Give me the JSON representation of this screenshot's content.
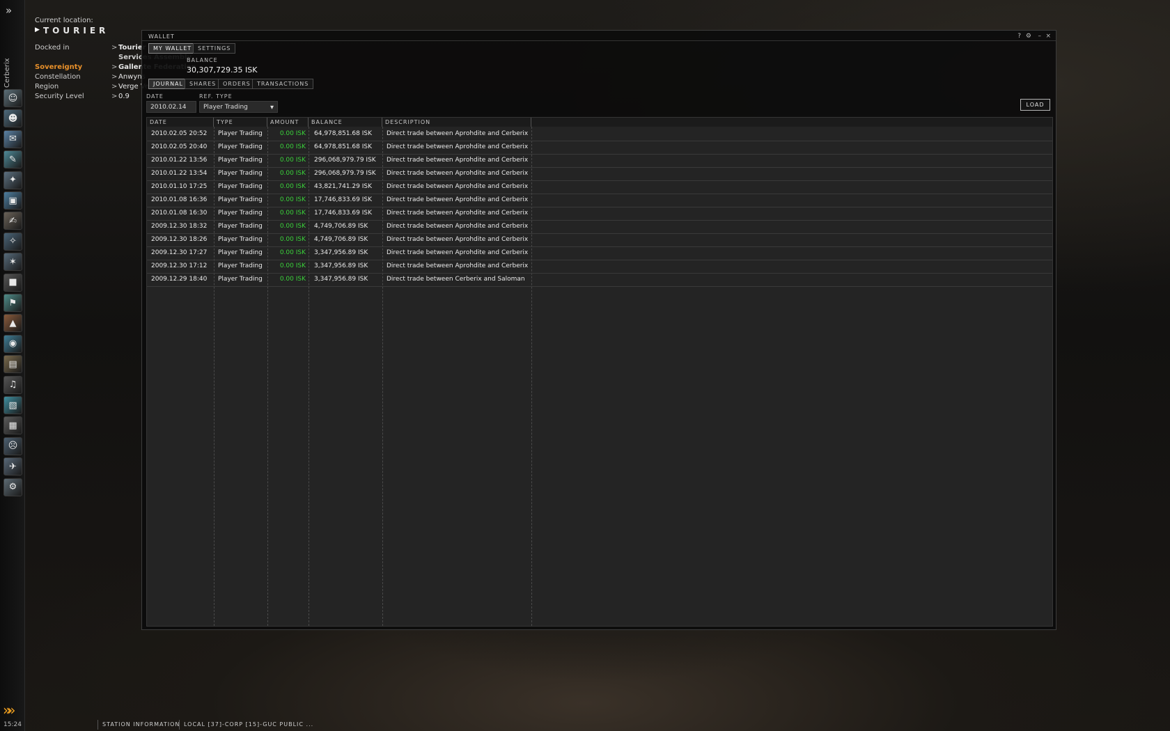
{
  "neocom": {
    "character_name": "Cerberix",
    "icons": [
      "character-sheet-icon",
      "people-icon",
      "mail-icon",
      "journal-icon",
      "market-icon",
      "assets-icon",
      "contracts-icon",
      "map-icon",
      "star-map-icon",
      "cargo-icon",
      "corporation-icon",
      "fleet-icon",
      "science-icon",
      "notepad-icon",
      "audio-icon",
      "wallet-icon",
      "militia-icon",
      "help-icon",
      "ship-icon",
      "drones-icon"
    ],
    "clock": "15:24"
  },
  "location": {
    "current_location_label": "Current location:",
    "station_name": "TOURIER",
    "rows": [
      {
        "label": "Docked in",
        "value": "Tourier",
        "extra": "Services  Assembly"
      },
      {
        "label": "Sovereignty",
        "value": "Gallente Federation"
      },
      {
        "label": "Constellation",
        "value": "Anwyns"
      },
      {
        "label": "Region",
        "value": "Verge Vendor"
      },
      {
        "label": "Security Level",
        "value": "0.9"
      }
    ],
    "sovereignty_color": "#e8902a"
  },
  "wallet": {
    "title": "WALLET",
    "controls": [
      "?",
      "⚙",
      "–",
      "×"
    ],
    "tabs": [
      "MY WALLET",
      "SETTINGS"
    ],
    "active_tab": "MY WALLET",
    "balance_label": "BALANCE",
    "balance_value": "30,307,729.35 ISK",
    "subtabs": [
      "JOURNAL",
      "SHARES",
      "ORDERS",
      "TRANSACTIONS"
    ],
    "active_subtab": "JOURNAL",
    "filters": {
      "date_label": "DATE",
      "date_value": "2010.02.14",
      "reftype_label": "REF. TYPE",
      "reftype_value": "Player Trading"
    },
    "load_label": "LOAD",
    "columns": [
      "DATE",
      "TYPE",
      "AMOUNT",
      "BALANCE",
      "DESCRIPTION"
    ],
    "rows": [
      {
        "date": "2010.02.05 20:52",
        "type": "Player Trading",
        "amount": "0.00 ISK",
        "balance": "64,978,851.68 ISK",
        "description": "Direct trade between Aprohdite and Cerberix"
      },
      {
        "date": "2010.02.05 20:40",
        "type": "Player Trading",
        "amount": "0.00 ISK",
        "balance": "64,978,851.68 ISK",
        "description": "Direct trade between Aprohdite and Cerberix"
      },
      {
        "date": "2010.01.22 13:56",
        "type": "Player Trading",
        "amount": "0.00 ISK",
        "balance": "296,068,979.79 ISK",
        "description": "Direct trade between Aprohdite and Cerberix"
      },
      {
        "date": "2010.01.22 13:54",
        "type": "Player Trading",
        "amount": "0.00 ISK",
        "balance": "296,068,979.79 ISK",
        "description": "Direct trade between Aprohdite and Cerberix"
      },
      {
        "date": "2010.01.10 17:25",
        "type": "Player Trading",
        "amount": "0.00 ISK",
        "balance": "43,821,741.29 ISK",
        "description": "Direct trade between Aprohdite and Cerberix"
      },
      {
        "date": "2010.01.08 16:36",
        "type": "Player Trading",
        "amount": "0.00 ISK",
        "balance": "17,746,833.69 ISK",
        "description": "Direct trade between Aprohdite and Cerberix"
      },
      {
        "date": "2010.01.08 16:30",
        "type": "Player Trading",
        "amount": "0.00 ISK",
        "balance": "17,746,833.69 ISK",
        "description": "Direct trade between Aprohdite and Cerberix"
      },
      {
        "date": "2009.12.30 18:32",
        "type": "Player Trading",
        "amount": "0.00 ISK",
        "balance": "4,749,706.89 ISK",
        "description": "Direct trade between Aprohdite and Cerberix"
      },
      {
        "date": "2009.12.30 18:26",
        "type": "Player Trading",
        "amount": "0.00 ISK",
        "balance": "4,749,706.89 ISK",
        "description": "Direct trade between Aprohdite and Cerberix"
      },
      {
        "date": "2009.12.30 17:27",
        "type": "Player Trading",
        "amount": "0.00 ISK",
        "balance": "3,347,956.89 ISK",
        "description": "Direct trade between Aprohdite and Cerberix"
      },
      {
        "date": "2009.12.30 17:12",
        "type": "Player Trading",
        "amount": "0.00 ISK",
        "balance": "3,347,956.89 ISK",
        "description": "Direct trade between Aprohdite and Cerberix"
      },
      {
        "date": "2009.12.29 18:40",
        "type": "Player Trading",
        "amount": "0.00 ISK",
        "balance": "3,347,956.89 ISK",
        "description": "Direct trade between Cerberix and Saloman"
      }
    ]
  },
  "bottom_bar": {
    "tabs": [
      "STATION INFORMATION",
      "LOCAL [37]-CORP [15]-GUC PUBLIC ..."
    ]
  },
  "colors": {
    "amount_green": "#3ad23a",
    "accent_orange": "#f0a020"
  }
}
